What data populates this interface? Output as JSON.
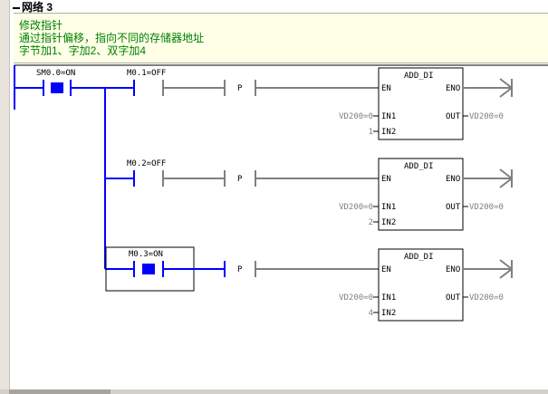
{
  "header": {
    "network_label": "网络 3"
  },
  "comment": {
    "line1": "修改指针",
    "line2": "通过指针偏移，指向不同的存储器地址",
    "line3": "字节加1、字加2、双字加4"
  },
  "rungs": [
    {
      "contact1": "SM0.0=ON",
      "contact2": "M0.1=OFF",
      "p_label": "P",
      "block": {
        "title": "ADD_DI",
        "en": "EN",
        "eno": "ENO",
        "in1_label": "IN1",
        "in2_label": "IN2",
        "out_label": "OUT",
        "in1_value": "VD200=0",
        "in2_value": "1",
        "out_value": "VD200=0"
      }
    },
    {
      "contact2": "M0.2=OFF",
      "p_label": "P",
      "block": {
        "title": "ADD_DI",
        "en": "EN",
        "eno": "ENO",
        "in1_label": "IN1",
        "in2_label": "IN2",
        "out_label": "OUT",
        "in1_value": "VD200=0",
        "in2_value": "2",
        "out_value": "VD200=0"
      }
    },
    {
      "contact2": "M0.3=ON",
      "p_label": "P",
      "block": {
        "title": "ADD_DI",
        "en": "EN",
        "eno": "ENO",
        "in1_label": "IN1",
        "in2_label": "IN2",
        "out_label": "OUT",
        "in1_value": "VD200=0",
        "in2_value": "4",
        "out_value": "VD200=0"
      }
    }
  ],
  "colors": {
    "energized": "#0000ff",
    "deenergized": "#808080",
    "comment_text": "#008000"
  }
}
